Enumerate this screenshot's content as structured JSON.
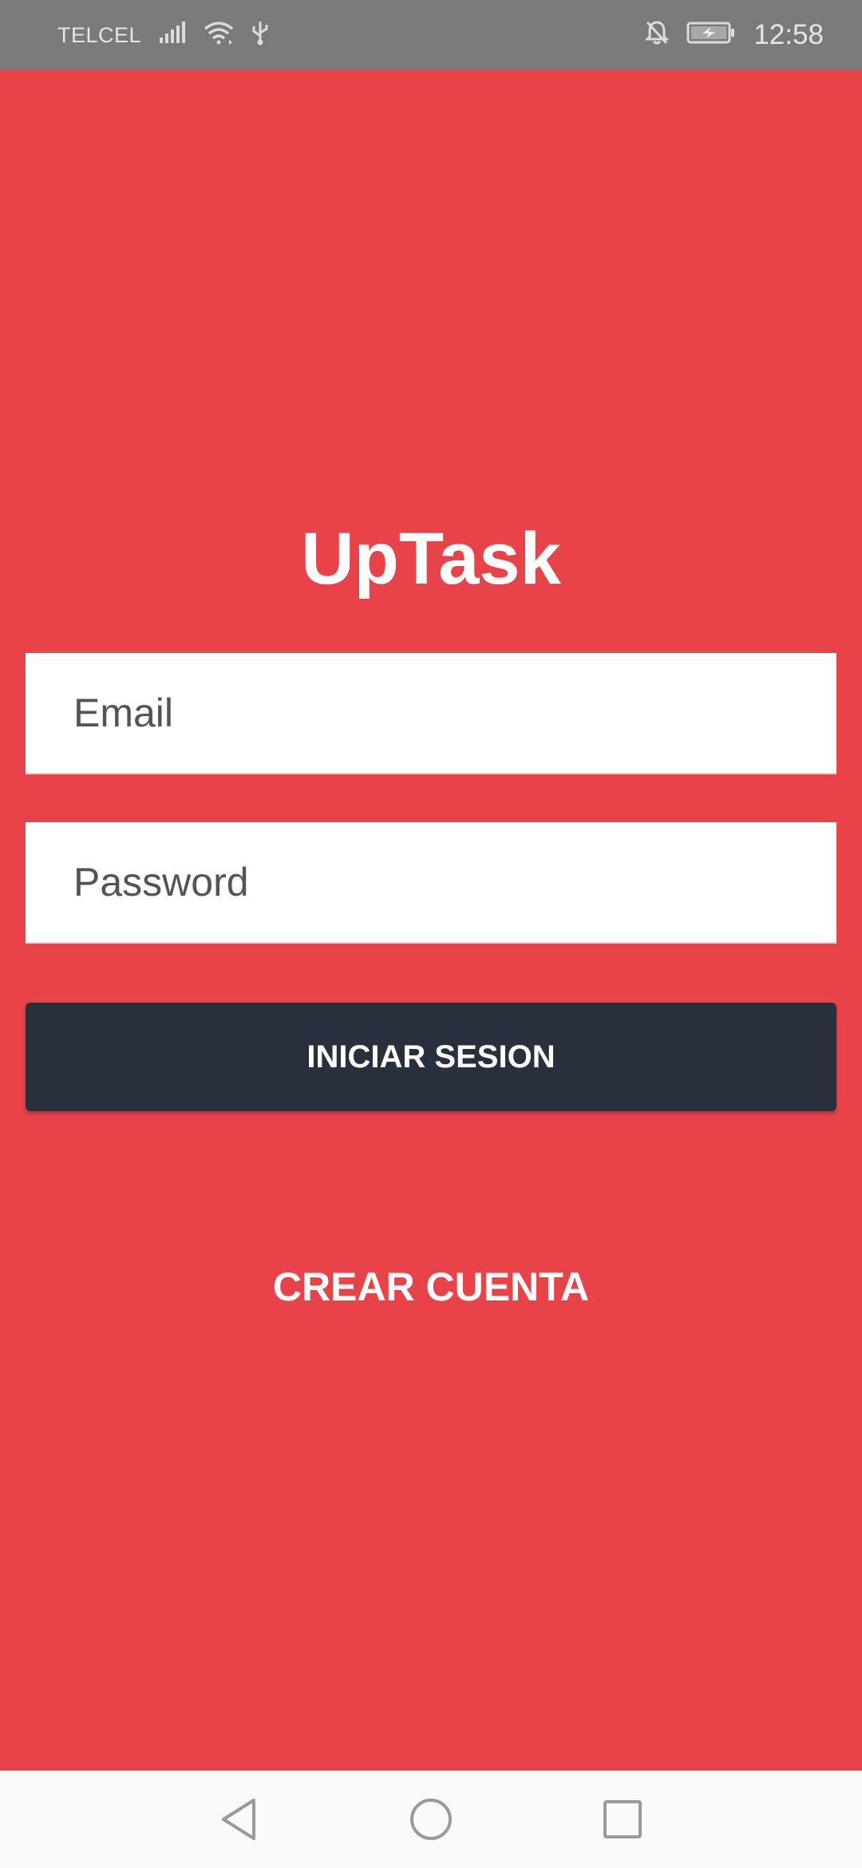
{
  "status_bar": {
    "carrier": "TELCEL",
    "time": "12:58",
    "icons": [
      "signal-icon",
      "wifi-icon",
      "usb-icon",
      "notifications-off-icon",
      "battery-charging-icon"
    ]
  },
  "app": {
    "title": "UpTask"
  },
  "login_form": {
    "email_placeholder": "Email",
    "email_value": "",
    "password_placeholder": "Password",
    "password_value": "",
    "submit_label": "INICIAR SESION"
  },
  "links": {
    "create_account_label": "CREAR CUENTA"
  },
  "nav_bar": {
    "buttons": [
      "back-icon",
      "home-icon",
      "recents-icon"
    ]
  },
  "colors": {
    "background": "#e84349",
    "button": "#28303d",
    "status_bar": "#7a7a7a"
  }
}
